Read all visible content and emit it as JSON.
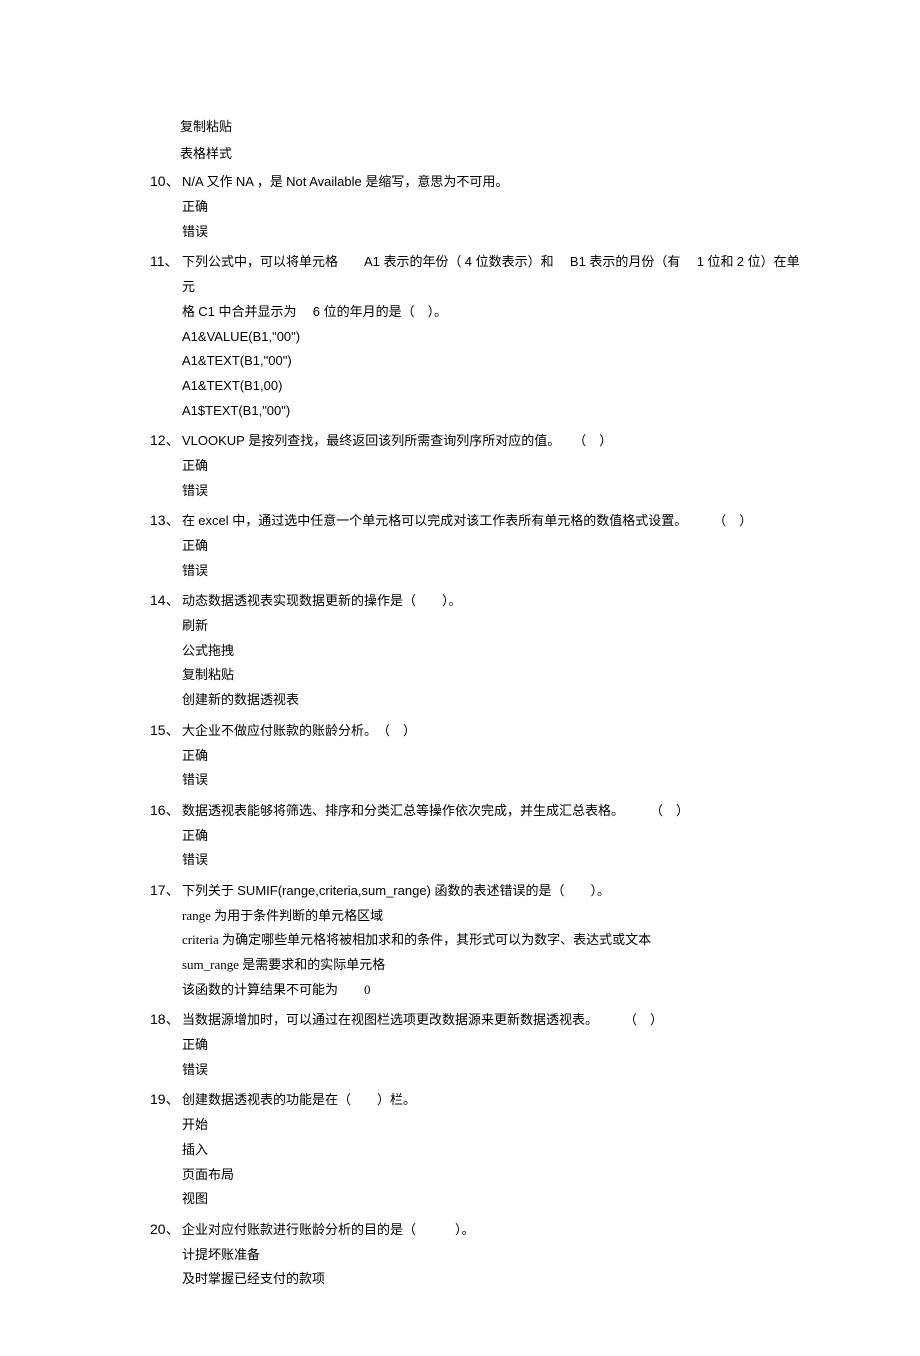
{
  "preOptions": [
    "复制粘贴",
    "表格样式"
  ],
  "questions": [
    {
      "num": "10、",
      "parts": [
        {
          "t": "ar",
          "v": "N/A "
        },
        {
          "t": "cn",
          "v": "又作 "
        },
        {
          "t": "ar",
          "v": "NA "
        },
        {
          "t": "cn",
          "v": "，是 "
        },
        {
          "t": "ar",
          "v": "Not Available "
        },
        {
          "t": "cn",
          "v": "是缩写，意思为不可用。"
        }
      ],
      "options": [
        "正确",
        "错误"
      ]
    },
    {
      "num": "11、",
      "parts": [
        {
          "t": "cn",
          "v": "下列公式中，可以将单元格　　"
        },
        {
          "t": "ar",
          "v": "A1 "
        },
        {
          "t": "cn",
          "v": "表示的年份（ "
        },
        {
          "t": "ar",
          "v": "4 "
        },
        {
          "t": "cn",
          "v": "位数表示）和　 "
        },
        {
          "t": "ar",
          "v": "B1 "
        },
        {
          "t": "cn",
          "v": "表示的月份（有　 "
        },
        {
          "t": "ar",
          "v": "1 "
        },
        {
          "t": "cn",
          "v": "位和 "
        },
        {
          "t": "ar",
          "v": "2 "
        },
        {
          "t": "cn",
          "v": "位）在单元"
        }
      ],
      "cont": [
        {
          "t": "cn",
          "v": "格 "
        },
        {
          "t": "ar",
          "v": "C1 "
        },
        {
          "t": "cn",
          "v": "中合并显示为　 "
        },
        {
          "t": "ar",
          "v": "6 "
        },
        {
          "t": "cn",
          "v": "位的年月的是（　）。"
        }
      ],
      "optionsMono": [
        "A1&VALUE(B1,\"00\")",
        "A1&TEXT(B1,\"00\")",
        "A1&TEXT(B1,00)",
        "A1$TEXT(B1,\"00\")"
      ]
    },
    {
      "num": "12、",
      "parts": [
        {
          "t": "ar",
          "v": " VLOOKUP  "
        },
        {
          "t": "cn",
          "v": "是按列查找，最终返回该列所需查询列序所对应的值。　　（　）"
        }
      ],
      "options": [
        "正确",
        "错误"
      ]
    },
    {
      "num": "13、",
      "parts": [
        {
          "t": "cn",
          "v": " 在 "
        },
        {
          "t": "ar",
          "v": "excel "
        },
        {
          "t": "cn",
          "v": "中，通过选中任意一个单元格可以完成对该工作表所有单元格的数值格式设置。　　　（　）"
        }
      ],
      "options": [
        "正确",
        "错误"
      ]
    },
    {
      "num": "14、",
      "parts": [
        {
          "t": "cn",
          "v": " 动态数据透视表实现数据更新的操作是（　　）。"
        }
      ],
      "options": [
        "刷新",
        "公式拖拽",
        "复制粘贴",
        "创建新的数据透视表"
      ]
    },
    {
      "num": "15、",
      "parts": [
        {
          "t": "cn",
          "v": " 大企业不做应付账款的账龄分析。　（　）"
        }
      ],
      "options": [
        "正确",
        "错误"
      ]
    },
    {
      "num": "16、",
      "parts": [
        {
          "t": "cn",
          "v": " 数据透视表能够将筛选、排序和分类汇总等操作依次完成，并生成汇总表格。　　　（　）"
        }
      ],
      "options": [
        "正确",
        "错误"
      ]
    },
    {
      "num": "17、",
      "parts": [
        {
          "t": "cn",
          "v": " 下列关于  "
        },
        {
          "t": "ar",
          "v": "SUMIF(range,criteria,sum_range) "
        },
        {
          "t": "cn",
          "v": "函数的表述错误的是（　　）。"
        }
      ],
      "mixedOptions": [
        [
          {
            "t": "ar",
            "v": "range "
          },
          {
            "t": "cn",
            "v": "为用于条件判断的单元格区域"
          }
        ],
        [
          {
            "t": "ar",
            "v": "criteria "
          },
          {
            "t": "cn",
            "v": "为确定哪些单元格将被相加求和的条件，其形式可以为数字、表达式或文本"
          }
        ],
        [
          {
            "t": "ar",
            "v": "sum_range "
          },
          {
            "t": "cn",
            "v": "是需要求和的实际单元格"
          }
        ],
        [
          {
            "t": "cn",
            "v": "该函数的计算结果不可能为　　"
          },
          {
            "t": "ar",
            "v": "0"
          }
        ]
      ]
    },
    {
      "num": "18、",
      "parts": [
        {
          "t": "cn",
          "v": " 当数据源增加时，可以通过在视图栏选项更改数据源来更新数据透视表。　　　（　）"
        }
      ],
      "options": [
        "正确",
        "错误"
      ]
    },
    {
      "num": "19、",
      "parts": [
        {
          "t": "cn",
          "v": " 创建数据透视表的功能是在（　　）栏。"
        }
      ],
      "options": [
        "开始",
        "插入",
        "页面布局",
        "视图"
      ]
    },
    {
      "num": "20、",
      "parts": [
        {
          "t": "cn",
          "v": " 企业对应付账款进行账龄分析的目的是（　　　）。"
        }
      ],
      "options": [
        "计提坏账准备",
        "及时掌握已经支付的款项"
      ]
    }
  ]
}
